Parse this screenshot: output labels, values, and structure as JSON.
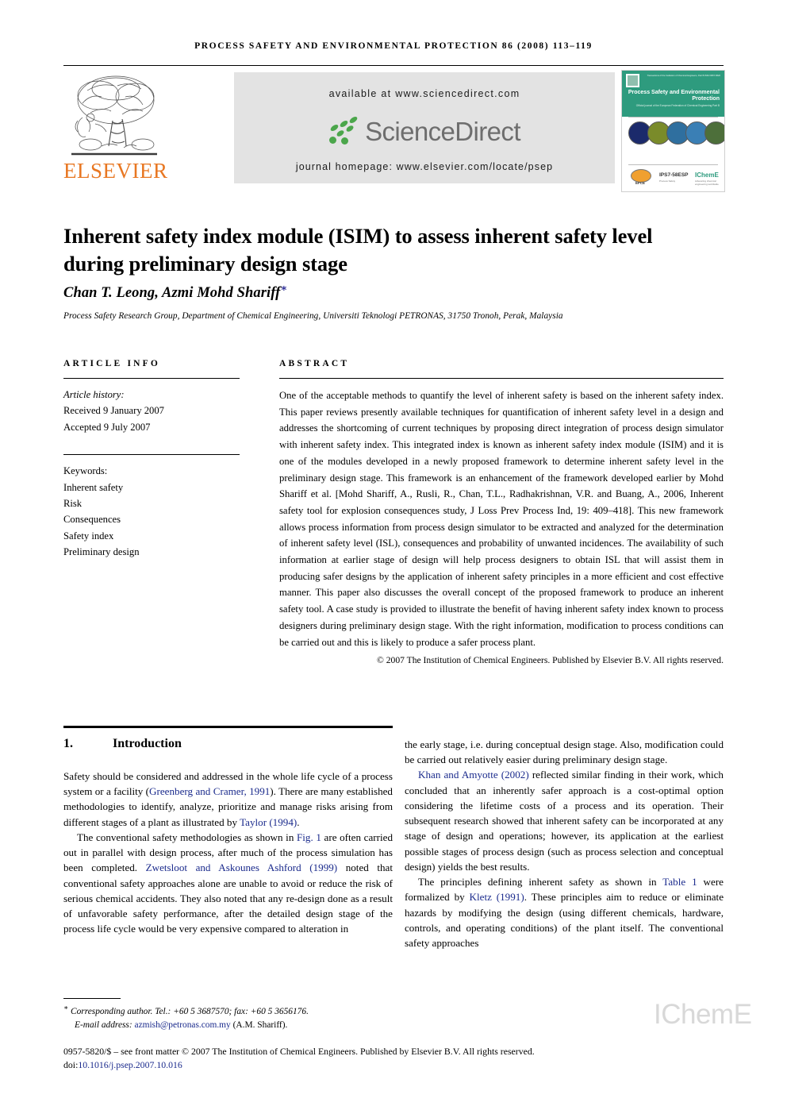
{
  "running_head": "Process Safety and Environmental Protection 86 (2008) 113–119",
  "masthead": {
    "publisher_name": "ELSEVIER",
    "available_at": "available at www.sciencedirect.com",
    "sciencedirect_wordmark": "ScienceDirect",
    "journal_homepage": "journal homepage: www.elsevier.com/locate/psep",
    "cover": {
      "org_line": "Transactions of the Institution of Chemical Engineers, Part B  ISSN 0957-5820",
      "title": "Process Safety and Environmental Protection",
      "subtitle": "Official journal of the European Federation of Chemical Engineering Part B",
      "efce_label": "EFCE",
      "psp_mark": "IPS7-58ESP",
      "psp_sub": "Process Safety",
      "icheme_mark": "IChemE",
      "icheme_sub": "Advancing chemical engineering worldwide"
    }
  },
  "article": {
    "title": "Inherent safety index module (ISIM) to assess inherent safety level during preliminary design stage",
    "authors": "Chan T. Leong, Azmi Mohd Shariff",
    "corresponding_marker": "∗",
    "affiliation": "Process Safety Research Group, Department of Chemical Engineering, Universiti Teknologi PETRONAS, 31750 Tronoh, Perak, Malaysia"
  },
  "article_info": {
    "heading": "Article info",
    "history_label": "Article history:",
    "received": "Received 9 January 2007",
    "accepted": "Accepted 9 July 2007",
    "keywords_label": "Keywords:",
    "keywords": [
      "Inherent safety",
      "Risk",
      "Consequences",
      "Safety index",
      "Preliminary design"
    ]
  },
  "abstract": {
    "heading": "Abstract",
    "text": "One of the acceptable methods to quantify the level of inherent safety is based on the inherent safety index. This paper reviews presently available techniques for quantification of inherent safety level in a design and addresses the shortcoming of current techniques by proposing direct integration of process design simulator with inherent safety index. This integrated index is known as inherent safety index module (ISIM) and it is one of the modules developed in a newly proposed framework to determine inherent safety level in the preliminary design stage. This framework is an enhancement of the framework developed earlier by Mohd Shariff et al. [Mohd Shariff, A., Rusli, R., Chan, T.L., Radhakrishnan, V.R. and Buang, A., 2006, Inherent safety tool for explosion consequences study, J Loss Prev Process Ind, 19: 409–418]. This new framework allows process information from process design simulator to be extracted and analyzed for the determination of inherent safety level (ISL), consequences and probability of unwanted incidences. The availability of such information at earlier stage of design will help process designers to obtain ISL that will assist them in producing safer designs by the application of inherent safety principles in a more efficient and cost effective manner. This paper also discusses the overall concept of the proposed framework to produce an inherent safety tool. A case study is provided to illustrate the benefit of having inherent safety index known to process designers during preliminary design stage. With the right information, modification to process conditions can be carried out and this is likely to produce a safer process plant.",
    "copyright": "© 2007 The Institution of Chemical Engineers. Published by Elsevier B.V. All rights reserved."
  },
  "section": {
    "number": "1.",
    "heading": "Introduction"
  },
  "body": {
    "left": {
      "p1_a": "Safety should be considered and addressed in the whole life cycle of a process system or a facility (",
      "p1_cite1": "Greenberg and Cramer, 1991",
      "p1_b": "). There are many established methodologies to identify, analyze, prioritize and manage risks arising from different stages of a plant as illustrated by ",
      "p1_cite2": "Taylor (1994)",
      "p1_c": ".",
      "p2_a": "The conventional safety methodologies as shown in ",
      "p2_cite1": "Fig. 1",
      "p2_b": " are often carried out in parallel with design process, after much of the process simulation has been completed. ",
      "p2_cite2": "Zwetsloot and Askounes Ashford (1999)",
      "p2_c": " noted that conventional safety approaches alone are unable to avoid or reduce the risk of serious chemical accidents. They also noted that any re-design done as a result of unfavorable safety performance, after the detailed design stage of the process life cycle would be very expensive compared to alteration in"
    },
    "right": {
      "p1": "the early stage, i.e. during conceptual design stage. Also, modification could be carried out relatively easier during preliminary design stage.",
      "p2_cite1": "Khan and Amyotte (2002)",
      "p2_a": " reflected similar finding in their work, which concluded that an inherently safer approach is a cost-optimal option considering the lifetime costs of a process and its operation. Their subsequent research showed that inherent safety can be incorporated at any stage of design and operations; however, its application at the earliest possible stages of process design (such as process selection and conceptual design) yields the best results.",
      "p3_a": "The principles defining inherent safety as shown in ",
      "p3_cite1": "Table 1",
      "p3_b": " were formalized by ",
      "p3_cite2": "Kletz (1991)",
      "p3_c": ". These principles aim to reduce or eliminate hazards by modifying the design (using different chemicals, hardware, controls, and operating conditions) of the plant itself. The conventional safety approaches"
    }
  },
  "footer": {
    "corresponding_note": "Corresponding author. Tel.: +60 5 3687570; fax: +60 5 3656176.",
    "email_label": "E-mail address:",
    "email": "azmish@petronas.com.my",
    "email_owner": "(A.M. Shariff).",
    "front_matter": "0957-5820/$ – see front matter © 2007 The Institution of Chemical Engineers. Published by Elsevier B.V. All rights reserved.",
    "doi_label": "doi:",
    "doi": "10.1016/j.psep.2007.10.016",
    "watermark": "IChemE"
  }
}
